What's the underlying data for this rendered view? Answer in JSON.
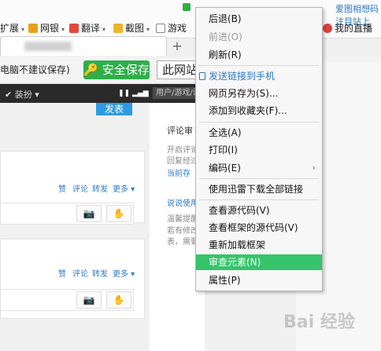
{
  "bookmarks": {
    "items": [
      {
        "label": "扩展"
      },
      {
        "label": "网银"
      },
      {
        "label": "翻译"
      },
      {
        "label": "截图"
      },
      {
        "label": "游戏"
      }
    ],
    "right_link": "我的直播",
    "top_text": "爱图相想码注目站上"
  },
  "address_bar": {
    "note": "电脑不建议保存)",
    "save_button": "安全保存",
    "input_value": "此网站"
  },
  "site": {
    "header_text": "✔ 装扮 ▾",
    "search_placeholder": "用户/游戏/话",
    "post_button": "发表",
    "feed_actions": [
      {
        "like": "赞",
        "comment": "评论",
        "forward": "转发",
        "more": "更多 ▾"
      },
      {
        "like": "赞",
        "comment": "评论",
        "forward": "转发",
        "more": "更多 ▾"
      }
    ],
    "side": {
      "title1": "评论审",
      "line1": "开启评论",
      "line2": "回复经过",
      "link1": "当前存",
      "title2": "说说使用",
      "line3": "温馨提醒",
      "line4": "若有修改",
      "line5": "表，需要"
    }
  },
  "context_menu": {
    "items": [
      {
        "label": "后退(B)",
        "state": "normal"
      },
      {
        "label": "前进(O)",
        "state": "disabled"
      },
      {
        "label": "刷新(R)",
        "state": "normal"
      },
      {
        "label": "发送链接到手机",
        "state": "blue"
      },
      {
        "label": "网页另存为(S)...",
        "state": "normal"
      },
      {
        "label": "添加到收藏夹(F)...",
        "state": "normal"
      },
      {
        "label": "全选(A)",
        "state": "normal"
      },
      {
        "label": "打印(I)",
        "state": "normal"
      },
      {
        "label": "编码(E)",
        "state": "normal"
      },
      {
        "label": "使用迅雷下载全部链接",
        "state": "normal"
      },
      {
        "label": "查看源代码(V)",
        "state": "normal"
      },
      {
        "label": "查看框架的源代码(V)",
        "state": "normal"
      },
      {
        "label": "重新加载框架",
        "state": "normal"
      },
      {
        "label": "审查元素(N)",
        "state": "highlighted"
      },
      {
        "label": "属性(P)",
        "state": "normal"
      }
    ]
  },
  "colors": {
    "menu_highlight": "#35c46a",
    "save_green": "#2fae4a",
    "link_blue": "#2c78c8"
  },
  "watermark": "Bai 经验"
}
